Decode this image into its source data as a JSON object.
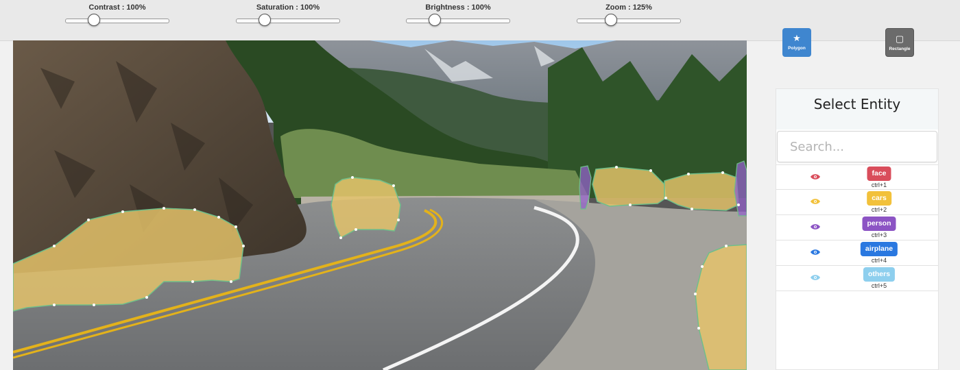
{
  "adjustments": [
    {
      "name": "contrast",
      "label": "Contrast : 100%",
      "value_percent": 100
    },
    {
      "name": "saturation",
      "label": "Saturation : 100%",
      "value_percent": 100
    },
    {
      "name": "brightness",
      "label": "Brightness : 100%",
      "value_percent": 100
    },
    {
      "name": "zoom",
      "label": "Zoom : 125%",
      "value_percent": 125
    }
  ],
  "tools": {
    "polygon": {
      "label": "Polygon",
      "icon": "star-icon",
      "color": "#3f86cf",
      "active": true
    },
    "rectangle": {
      "label": "Rectangle",
      "icon": "square-icon",
      "color": "#6b6b6b",
      "active": false
    }
  },
  "panel": {
    "title": "Select Entity",
    "search_placeholder": "Search..."
  },
  "entities": [
    {
      "label": "face",
      "shortcut": "ctrl+1",
      "color": "#d94d5b",
      "visible": true
    },
    {
      "label": "cars",
      "shortcut": "ctrl+2",
      "color": "#f2c13b",
      "visible": true
    },
    {
      "label": "person",
      "shortcut": "ctrl+3",
      "color": "#8c54c4",
      "visible": true
    },
    {
      "label": "airplane",
      "shortcut": "ctrl+4",
      "color": "#2a78e0",
      "visible": true
    },
    {
      "label": "others",
      "shortcut": "ctrl+5",
      "color": "#8ecfee",
      "visible": true
    }
  ],
  "annotation_colors": {
    "cars": "#e7c56a",
    "person": "#9361c9",
    "outline": "#6fbf8a"
  }
}
